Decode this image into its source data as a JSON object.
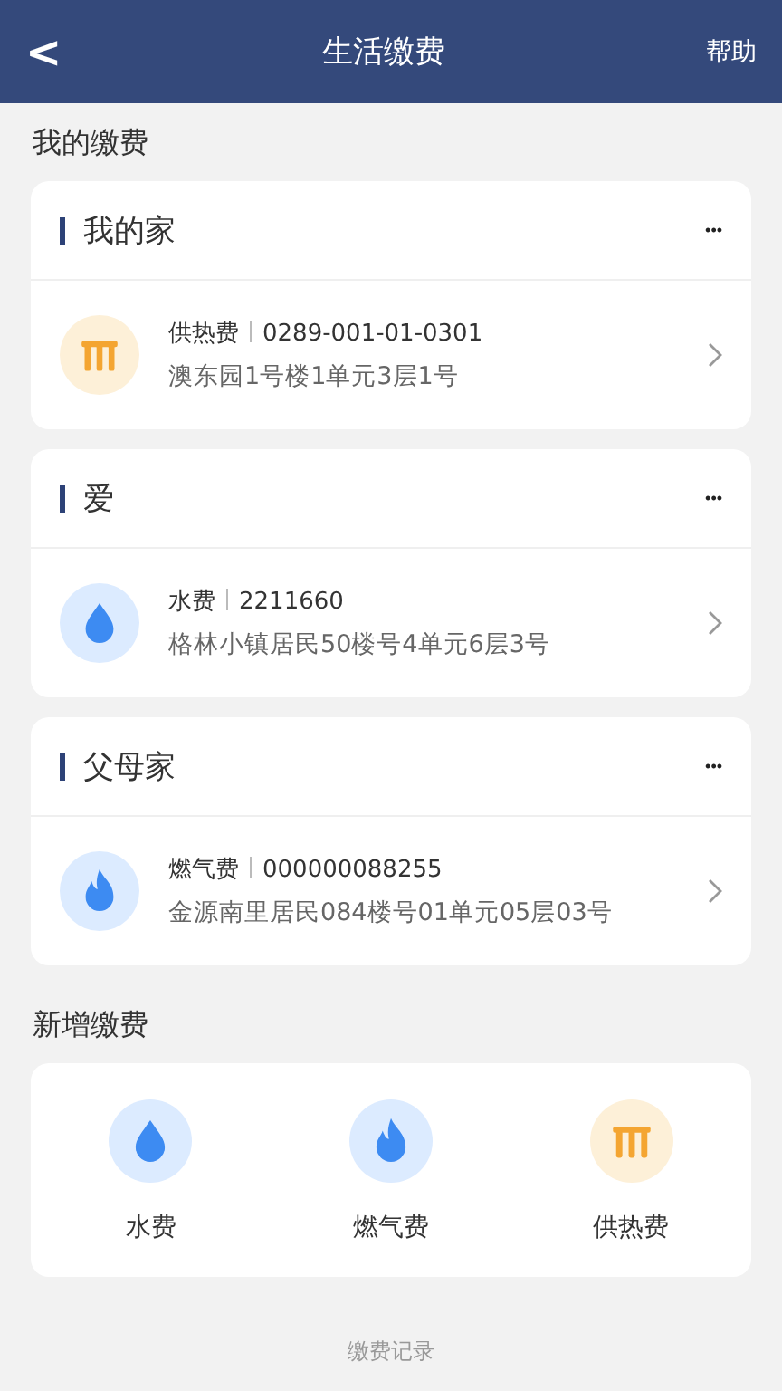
{
  "header": {
    "back": "<",
    "title": "生活缴费",
    "help": "帮助"
  },
  "my_section": {
    "title": "我的缴费"
  },
  "groups": [
    {
      "name": "我的家",
      "more": "•••",
      "account": {
        "kind": "heat",
        "type": "供热费",
        "number": "0289-001-01-0301",
        "address": "澳东园1号楼1单元3层1号"
      }
    },
    {
      "name": "爱",
      "more": "•••",
      "account": {
        "kind": "water",
        "type": "水费",
        "number": "2211660",
        "address": "格林小镇居民50楼号4单元6层3号"
      }
    },
    {
      "name": "父母家",
      "more": "•••",
      "account": {
        "kind": "gas",
        "type": "燃气费",
        "number": "000000088255",
        "address": "金源南里居民084楼号01单元05层03号"
      }
    }
  ],
  "new_section": {
    "title": "新增缴费",
    "items": [
      {
        "kind": "water",
        "label": "水费"
      },
      {
        "kind": "gas",
        "label": "燃气费"
      },
      {
        "kind": "heat",
        "label": "供热费"
      }
    ]
  },
  "footer": {
    "link": "缴费记录"
  }
}
